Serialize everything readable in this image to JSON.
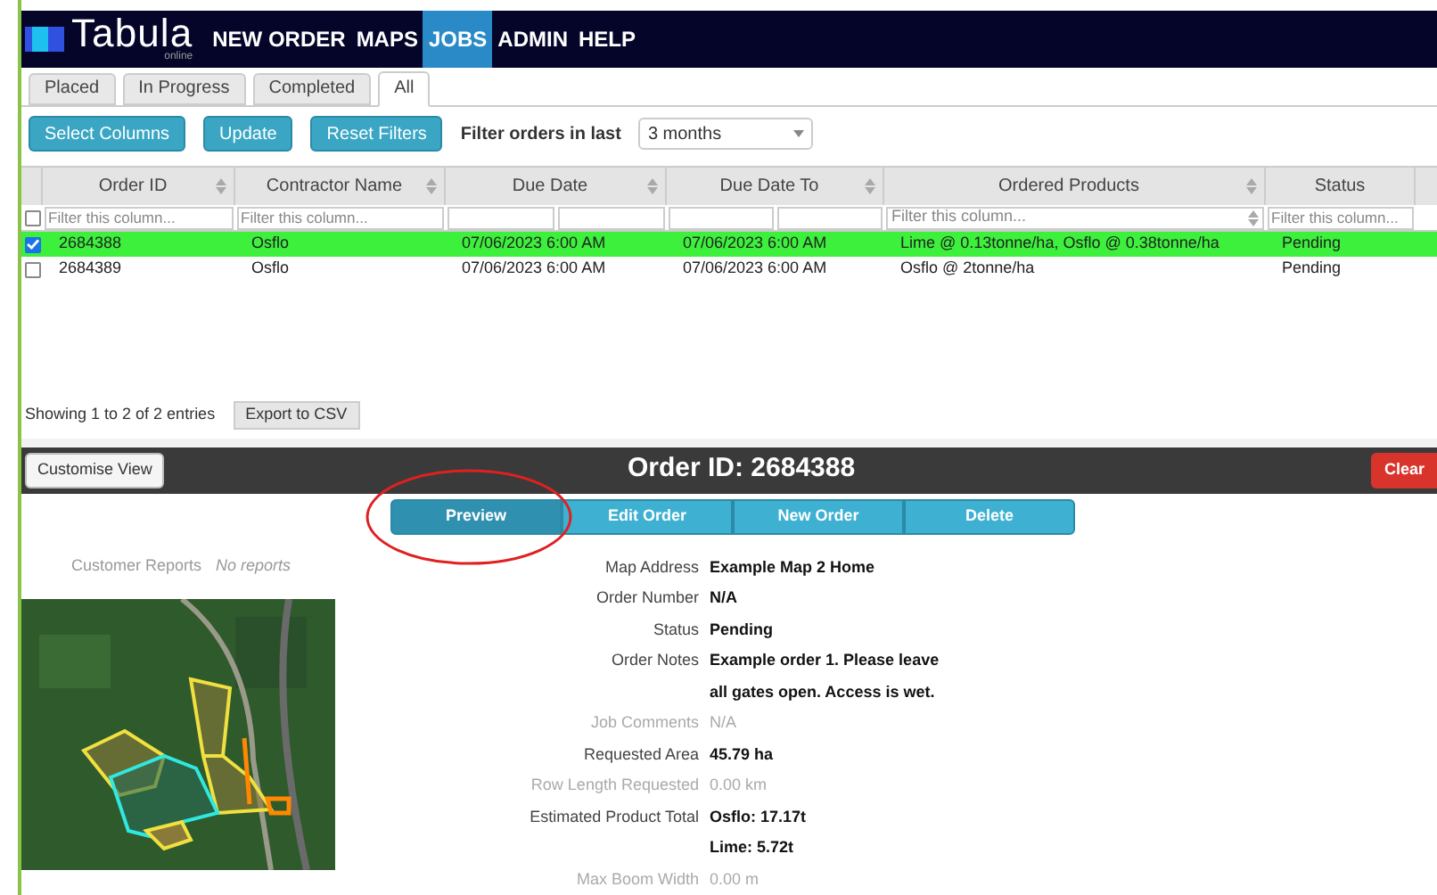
{
  "nav": {
    "logo": "Tabula",
    "logo_sub": "online",
    "items": [
      {
        "label": "NEW ORDER",
        "selected": false
      },
      {
        "label": "MAPS",
        "selected": false
      },
      {
        "label": "JOBS",
        "selected": true
      },
      {
        "label": "ADMIN",
        "selected": false
      },
      {
        "label": "HELP",
        "selected": false
      }
    ]
  },
  "tabs": [
    {
      "label": "Placed",
      "selected": false
    },
    {
      "label": "In Progress",
      "selected": false
    },
    {
      "label": "Completed",
      "selected": false
    },
    {
      "label": "All",
      "selected": true
    }
  ],
  "toolbar": {
    "buttons": [
      "Select Columns",
      "Update",
      "Reset Filters"
    ],
    "filter_label": "Filter orders in last",
    "filter_value": "3 months"
  },
  "table": {
    "select_all_checked": false,
    "columns": [
      {
        "label": "Order ID",
        "kind": "text",
        "placeholder": "Filter this column..."
      },
      {
        "label": "Contractor Name",
        "kind": "text",
        "placeholder": "Filter this column..."
      },
      {
        "label": "Due Date",
        "kind": "range"
      },
      {
        "label": "Due Date To",
        "kind": "range"
      },
      {
        "label": "Ordered Products",
        "kind": "select",
        "placeholder": "Filter this column..."
      },
      {
        "label": "Status",
        "kind": "text",
        "placeholder": "Filter this column..."
      }
    ],
    "rows": [
      {
        "selected": true,
        "cells": [
          "2684388",
          "Osflo",
          "07/06/2023 6:00 AM",
          "07/06/2023 6:00 AM",
          "Lime @ 0.13tonne/ha, Osflo @ 0.38tonne/ha",
          "Pending"
        ]
      },
      {
        "selected": false,
        "cells": [
          "2684389",
          "Osflo",
          "07/06/2023 6:00 AM",
          "07/06/2023 6:00 AM",
          "Osflo @ 2tonne/ha",
          "Pending"
        ]
      }
    ],
    "info": "Showing 1 to 2 of 2 entries",
    "export": "Export to CSV"
  },
  "detail_bar": {
    "customise": "Customise View",
    "title": "Order ID: 2684388",
    "clear": "Clear"
  },
  "actions": [
    {
      "label": "Preview",
      "highlighted": true
    },
    {
      "label": "Edit Order",
      "highlighted": false
    },
    {
      "label": "New Order",
      "highlighted": false
    },
    {
      "label": "Delete",
      "highlighted": false
    }
  ],
  "reports": {
    "label": "Customer Reports",
    "value": "No reports"
  },
  "details": [
    {
      "label": "Map Address",
      "values": [
        "Example Map 2 Home"
      ],
      "muted": false
    },
    {
      "label": "Order Number",
      "values": [
        "N/A"
      ],
      "muted": false
    },
    {
      "label": "Status",
      "values": [
        "Pending"
      ],
      "muted": false
    },
    {
      "label": "Order Notes",
      "values": [
        "Example order 1. Please leave all gates open. Access is wet."
      ],
      "muted": false
    },
    {
      "label": "Job Comments",
      "values": [
        "N/A"
      ],
      "muted": true
    },
    {
      "label": "Requested Area",
      "values": [
        "45.79 ha"
      ],
      "muted": false
    },
    {
      "label": "Row Length Requested",
      "values": [
        "0.00 km"
      ],
      "muted": true
    },
    {
      "label": "Estimated Product Total",
      "values": [
        "Osflo: 17.17t",
        "Lime: 5.72t"
      ],
      "muted": false
    },
    {
      "label": "Max Boom Width",
      "values": [
        "0.00 m"
      ],
      "muted": true
    }
  ]
}
